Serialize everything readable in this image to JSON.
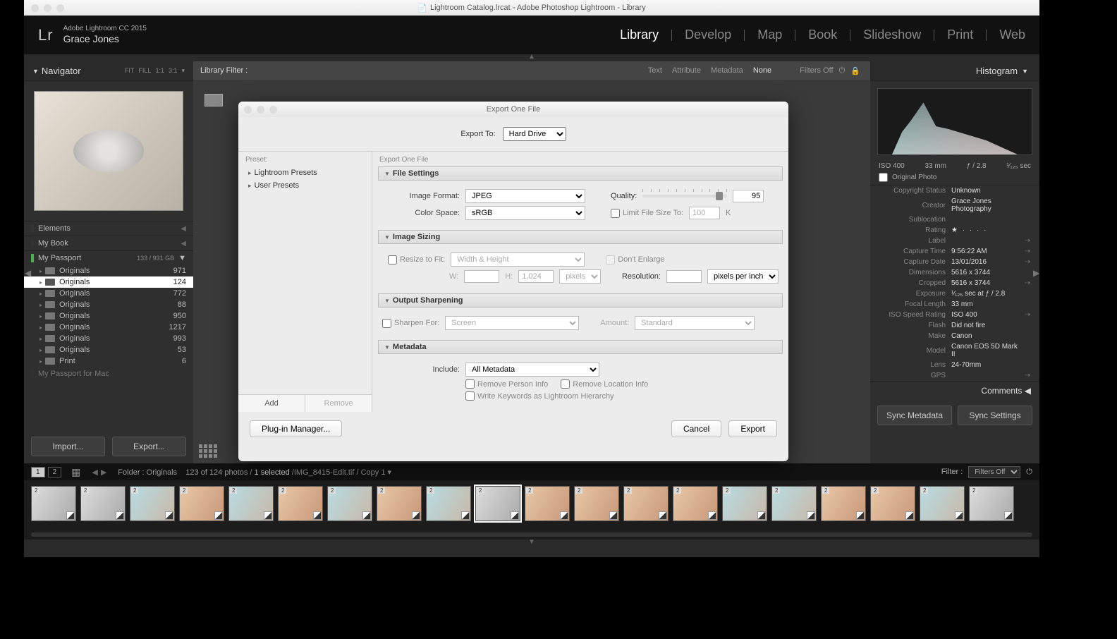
{
  "window_title": "Lightroom Catalog.lrcat - Adobe Photoshop Lightroom - Library",
  "identity": {
    "product": "Adobe Lightroom CC 2015",
    "user": "Grace Jones",
    "logo": "Lr"
  },
  "modules": {
    "items": [
      "Library",
      "Develop",
      "Map",
      "Book",
      "Slideshow",
      "Print",
      "Web"
    ],
    "active": "Library"
  },
  "navigator": {
    "title": "Navigator",
    "modes": [
      "FIT",
      "FILL",
      "1:1",
      "3:1"
    ]
  },
  "folders": {
    "panels": [
      {
        "name": "Elements"
      },
      {
        "name": "My Book"
      },
      {
        "name": "My Passport",
        "capacity": "133 / 931 GB",
        "green": true
      }
    ],
    "list": [
      {
        "name": "Originals",
        "count": 971
      },
      {
        "name": "Originals",
        "count": 124,
        "selected": true
      },
      {
        "name": "Originals",
        "count": 772
      },
      {
        "name": "Originals",
        "count": 88
      },
      {
        "name": "Originals",
        "count": 950
      },
      {
        "name": "Originals",
        "count": 1217
      },
      {
        "name": "Originals",
        "count": 993
      },
      {
        "name": "Originals",
        "count": 53
      },
      {
        "name": "Print",
        "count": 6
      }
    ],
    "truncated": "My Passport for Mac",
    "import_btn": "Import...",
    "export_btn": "Export..."
  },
  "filterbar": {
    "label": "Library Filter :",
    "tabs": [
      "Text",
      "Attribute",
      "Metadata",
      "None"
    ],
    "active": "None",
    "filters_off": "Filters Off"
  },
  "histogram": {
    "title": "Histogram",
    "iso": "ISO 400",
    "focal": "33 mm",
    "aperture": "ƒ / 2.8",
    "shutter": "¹⁄₁₂₅ sec",
    "original_photo": "Original Photo"
  },
  "metadata": {
    "copyright": {
      "k": "Copyright Status",
      "v": "Unknown"
    },
    "creator": {
      "k": "Creator",
      "v": "Grace Jones Photography"
    },
    "sublocation": {
      "k": "Sublocation",
      "v": ""
    },
    "rating": {
      "k": "Rating",
      "v": "★ · · · ·"
    },
    "label": {
      "k": "Label",
      "v": ""
    },
    "capture_time": {
      "k": "Capture Time",
      "v": "9:56:22 AM"
    },
    "capture_date": {
      "k": "Capture Date",
      "v": "13/01/2016"
    },
    "dimensions": {
      "k": "Dimensions",
      "v": "5616 x 3744"
    },
    "cropped": {
      "k": "Cropped",
      "v": "5616 x 3744"
    },
    "exposure": {
      "k": "Exposure",
      "v": "¹⁄₁₂₅ sec at ƒ / 2.8"
    },
    "focal_length": {
      "k": "Focal Length",
      "v": "33 mm"
    },
    "iso_speed": {
      "k": "ISO Speed Rating",
      "v": "ISO 400"
    },
    "flash": {
      "k": "Flash",
      "v": "Did not fire"
    },
    "make": {
      "k": "Make",
      "v": "Canon"
    },
    "model": {
      "k": "Model",
      "v": "Canon EOS 5D Mark II"
    },
    "lens": {
      "k": "Lens",
      "v": "24-70mm"
    },
    "gps": {
      "k": "GPS",
      "v": ""
    }
  },
  "comments": "Comments",
  "sync": {
    "meta": "Sync Metadata",
    "settings": "Sync Settings"
  },
  "toolbar2": {
    "pages": [
      "1",
      "2"
    ],
    "folder_label": "Folder : Originals",
    "count": "123 of 124 photos /",
    "selected": "1 selected",
    "filename": "/IMG_8415-Edit.tif / Copy 1",
    "filter_label": "Filter :",
    "filter_value": "Filters Off"
  },
  "filmstrip": {
    "badge": "2",
    "count": 20
  },
  "dialog": {
    "title": "Export One File",
    "export_to_label": "Export To:",
    "export_to_value": "Hard Drive",
    "preset_header": "Preset:",
    "right_header": "Export One File",
    "presets": [
      "Lightroom Presets",
      "User Presets"
    ],
    "add": "Add",
    "remove": "Remove",
    "sections": {
      "file_settings": {
        "title": "File Settings",
        "image_format": "Image Format:",
        "image_format_v": "JPEG",
        "quality": "Quality:",
        "quality_v": "95",
        "color_space": "Color Space:",
        "color_space_v": "sRGB",
        "limit": "Limit File Size To:",
        "limit_v": "100",
        "limit_unit": "K"
      },
      "image_sizing": {
        "title": "Image Sizing",
        "resize": "Resize to Fit:",
        "resize_v": "Width & Height",
        "dont_enlarge": "Don't Enlarge",
        "w": "W:",
        "h": "H:",
        "h_v": "1,024",
        "units": "pixels",
        "resolution": "Resolution:",
        "res_units": "pixels per inch"
      },
      "sharpening": {
        "title": "Output Sharpening",
        "sharpen": "Sharpen For:",
        "sharpen_v": "Screen",
        "amount": "Amount:",
        "amount_v": "Standard"
      },
      "metadata": {
        "title": "Metadata",
        "include": "Include:",
        "include_v": "All Metadata",
        "remove_person": "Remove Person Info",
        "remove_location": "Remove Location Info",
        "write_kw": "Write Keywords as Lightroom Hierarchy"
      }
    },
    "plugin_mgr": "Plug-in Manager...",
    "cancel": "Cancel",
    "export": "Export"
  }
}
